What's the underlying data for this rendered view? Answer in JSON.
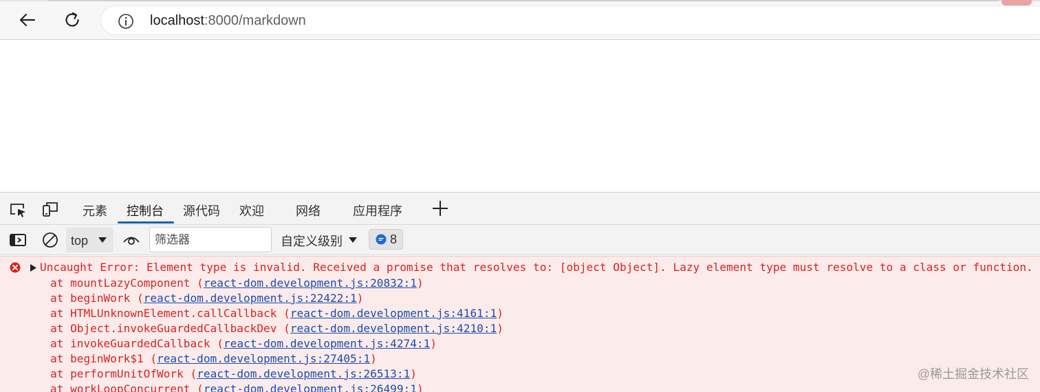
{
  "browser": {
    "url_host": "localhost",
    "url_path": ":8000/markdown",
    "icons": {
      "back": "arrow-left-icon",
      "reload": "reload-icon",
      "info": "info-icon"
    }
  },
  "devtools": {
    "tabs": [
      {
        "label": "元素",
        "active": false
      },
      {
        "label": "控制台",
        "active": true
      },
      {
        "label": "源代码",
        "active": false
      },
      {
        "label": "欢迎",
        "active": false
      },
      {
        "label": "网络",
        "active": false
      },
      {
        "label": "应用程序",
        "active": false
      }
    ],
    "toolbar": {
      "context": "top",
      "filter_placeholder": "筛选器",
      "levels": "自定义级别",
      "message_count": "8"
    }
  },
  "console": {
    "error_message": "Uncaught Error: Element type is invalid. Received a promise that resolves to: [object Object]. Lazy element type must resolve to a class or function.",
    "stack": [
      {
        "fn": "at mountLazyComponent",
        "src": "react-dom.development.js:20832:1"
      },
      {
        "fn": "at beginWork",
        "src": "react-dom.development.js:22422:1"
      },
      {
        "fn": "at HTMLUnknownElement.callCallback",
        "src": "react-dom.development.js:4161:1"
      },
      {
        "fn": "at Object.invokeGuardedCallbackDev",
        "src": "react-dom.development.js:4210:1"
      },
      {
        "fn": "at invokeGuardedCallback",
        "src": "react-dom.development.js:4274:1"
      },
      {
        "fn": "at beginWork$1",
        "src": "react-dom.development.js:27405:1"
      },
      {
        "fn": "at performUnitOfWork",
        "src": "react-dom.development.js:26513:1"
      },
      {
        "fn": "at workLoopConcurrent",
        "src": "react-dom.development.js:26499:1"
      }
    ]
  },
  "watermark": "@稀土掘金技术社区",
  "colors": {
    "error": "#d8241f",
    "link": "#1a4db0",
    "console_bg": "#fcebeb",
    "accent": "#1a5fb4"
  }
}
